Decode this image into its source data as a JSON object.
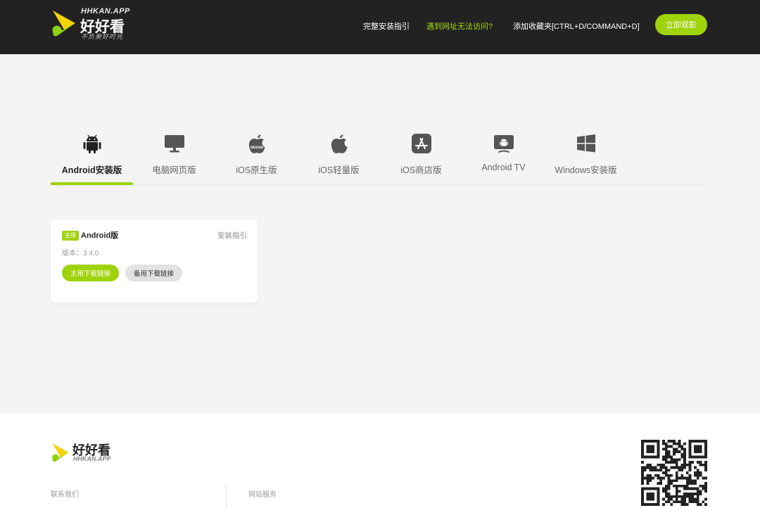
{
  "header": {
    "logo_en": "HHKAN.APP",
    "logo_cn": "好好看",
    "logo_slogan": "不负美好时光",
    "nav": {
      "guide": "完整安装指引",
      "access": "遇到网址无法访问?",
      "bookmark": "添加收藏夹[CTRL+D/COMMAND+D]"
    },
    "watch_button": "立即观影"
  },
  "tabs": [
    {
      "label": "Android安装版",
      "icon": "android-icon",
      "active": true
    },
    {
      "label": "电脑网页版",
      "icon": "monitor-icon",
      "active": false
    },
    {
      "label": "iOS原生版",
      "icon": "apple-design-icon",
      "active": false
    },
    {
      "label": "iOS轻量版",
      "icon": "apple-icon",
      "active": false
    },
    {
      "label": "iOS商店版",
      "icon": "app-store-icon",
      "active": false
    },
    {
      "label": "Android TV",
      "icon": "android-tv-icon",
      "active": false
    },
    {
      "label": "Windows安装版",
      "icon": "windows-icon",
      "active": false
    }
  ],
  "card": {
    "badge": "主用",
    "title": "Android版",
    "guide_link": "安装指引",
    "version": "版本：3.4.0",
    "primary_button": "主用下载链接",
    "secondary_button": "备用下载链接"
  },
  "footer": {
    "logo_cn": "好好看",
    "logo_en": "HHKAN.APP",
    "contact": "联系我们",
    "service": "网站服务"
  },
  "colors": {
    "accent": "#9fd30c",
    "header_bg": "#222222",
    "page_bg": "#f4f4f4"
  }
}
